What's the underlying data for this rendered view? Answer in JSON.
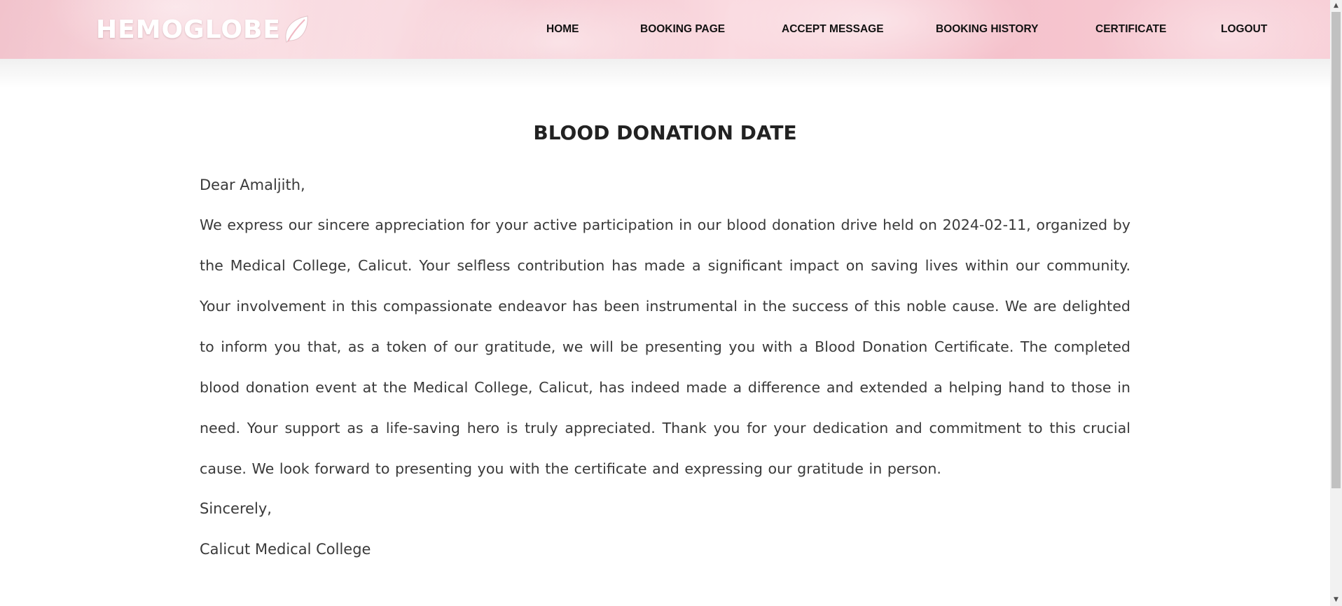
{
  "brand": {
    "logo_text": "HEMOGLOBE"
  },
  "nav": {
    "items": [
      {
        "label": "HOME"
      },
      {
        "label": "BOOKING PAGE"
      },
      {
        "label": "ACCEPT MESSAGE"
      },
      {
        "label": "BOOKING HISTORY"
      },
      {
        "label": "CERTIFICATE"
      },
      {
        "label": "LOGOUT"
      }
    ]
  },
  "page": {
    "heading": "BLOOD DONATION DATE"
  },
  "letter": {
    "greeting": "Dear Amaljith,",
    "body": "We express our sincere appreciation for your active participation in our blood donation drive held on 2024-02-11, organized by the Medical College, Calicut. Your selfless contribution has made a significant impact on saving lives within our community. Your involvement in this compassionate endeavor has been instrumental in the success of this noble cause. We are delighted to inform you that, as a token of our gratitude, we will be presenting you with a Blood Donation Certificate. The completed blood donation event at the Medical College, Calicut, has indeed made a difference and extended a helping hand to those in need. Your support as a life-saving hero is truly appreciated. Thank you for your dedication and commitment to this crucial cause. We look forward to presenting you with the certificate and expressing our gratitude in person.",
    "closing": "Sincerely,",
    "signature": "Calicut Medical College"
  },
  "icons": {
    "logo": "leaf-icon",
    "scroll_up": "scroll-up-arrow-icon",
    "scroll_down": "scroll-down-arrow-icon"
  },
  "colors": {
    "navbar_pink": "#f4c3cc",
    "heading_text": "#222222",
    "body_text": "#3a3a3a",
    "nav_text": "#111111",
    "logo_text": "#ffffff"
  }
}
